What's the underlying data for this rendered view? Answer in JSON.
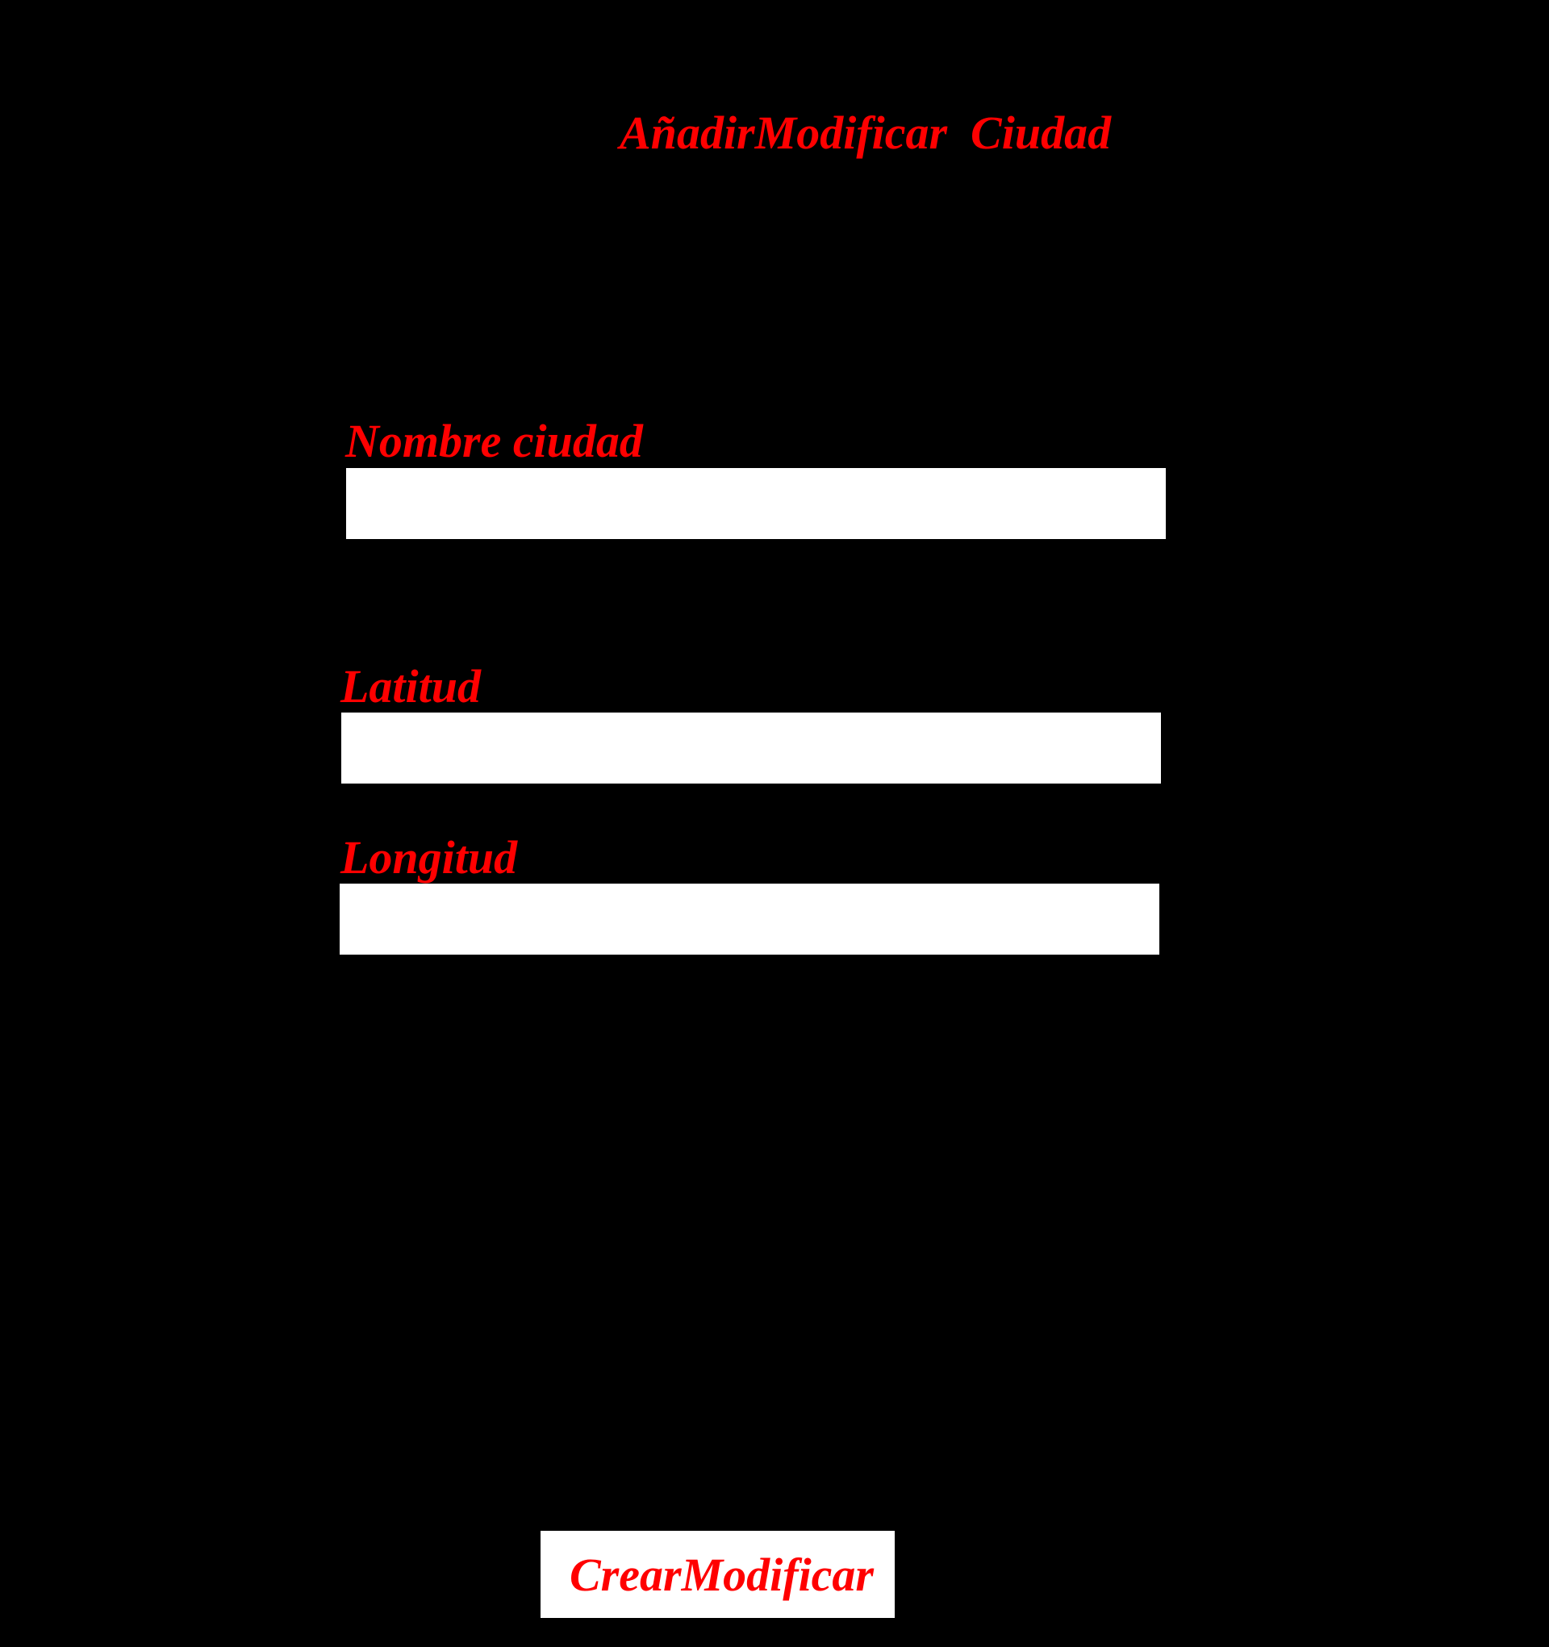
{
  "page": {
    "title": "AñadirModificar  Ciudad"
  },
  "form": {
    "nombre": {
      "label": "Nombre ciudad",
      "value": ""
    },
    "latitud": {
      "label": "Latitud",
      "value": ""
    },
    "longitud": {
      "label": "Longitud",
      "value": ""
    },
    "submit_label": "CrearModificar"
  },
  "colors": {
    "background": "#000000",
    "text": "#ff0000",
    "field": "#ffffff"
  }
}
